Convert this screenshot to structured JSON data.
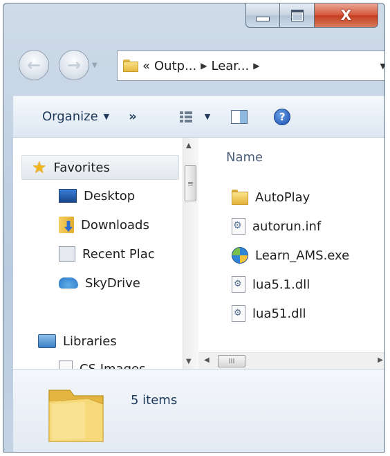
{
  "window": {
    "caption_buttons": {
      "minimize": "minimize-icon",
      "maximize": "maximize-icon",
      "close": "close-icon",
      "close_glyph": "X"
    }
  },
  "address_bar": {
    "overflow": "«",
    "segments": [
      "Outp...",
      "Lear..."
    ],
    "separator": "▶",
    "dropdown": "▼"
  },
  "toolbar": {
    "organize_label": "Organize",
    "more_label": "»",
    "caret": "▼",
    "help": "?"
  },
  "navigation_pane": {
    "items": [
      {
        "label": "Favorites",
        "icon": "star-icon",
        "selected": true
      },
      {
        "label": "Desktop",
        "icon": "desktop-icon"
      },
      {
        "label": "Downloads",
        "icon": "downloads-icon"
      },
      {
        "label": "Recent Plac",
        "icon": "recent-places-icon"
      },
      {
        "label": "SkyDrive",
        "icon": "skydrive-icon"
      },
      {
        "label": "Libraries",
        "icon": "libraries-icon"
      },
      {
        "label": "CS Images",
        "icon": "document-icon"
      }
    ]
  },
  "file_list": {
    "column_header": "Name",
    "files": [
      {
        "name": "AutoPlay",
        "icon": "folder-icon"
      },
      {
        "name": "autorun.inf",
        "icon": "settings-file-icon"
      },
      {
        "name": "Learn_AMS.exe",
        "icon": "application-icon"
      },
      {
        "name": "lua5.1.dll",
        "icon": "dll-icon"
      },
      {
        "name": "lua51.dll",
        "icon": "dll-icon"
      }
    ]
  },
  "scrollbars": {
    "grip": "≡",
    "hgrip": "III",
    "up": "▲",
    "down": "▼",
    "left": "◀",
    "right": "▶"
  },
  "details_pane": {
    "item_count": "5 items"
  },
  "colors": {
    "chrome": "#b9cbe0",
    "toolbar": "#dde7f2",
    "accent_text": "#1f3a5a",
    "close_button": "#c33d1f"
  }
}
